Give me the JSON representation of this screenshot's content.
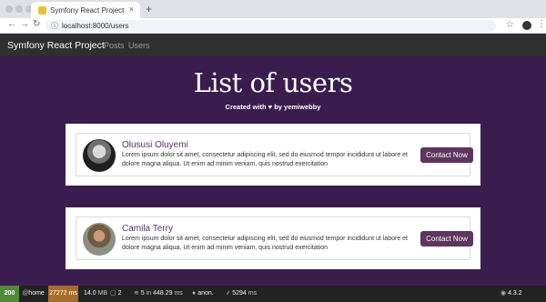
{
  "browser": {
    "tab_title": "Symfony React Project",
    "new_tab_label": "+",
    "close_label": "×",
    "url": "localhost:8000/users",
    "icons": {
      "back": "back-arrow-icon",
      "forward": "forward-arrow-icon",
      "reload": "reload-icon",
      "info": "info-icon",
      "star": "star-icon",
      "menu": "kebab-menu-icon"
    }
  },
  "navbar": {
    "brand": "Symfony React Project",
    "links": [
      {
        "label": "Posts"
      },
      {
        "label": "Users"
      }
    ]
  },
  "page": {
    "title": "List of users",
    "subtitle_prefix": "Created with",
    "subtitle_suffix": "by yemiwebby"
  },
  "users": [
    {
      "name": "Olususi Oluyemi",
      "bio": "Lorem ipsum dolor sit amet, consectetur adipiscing elit, sed do eiusmod tempor incididunt ut labore et dolore magna aliqua. Ut enim ad minim veniam, quis nostrud exercitation",
      "button": "Contact Now"
    },
    {
      "name": "Camila Terry",
      "bio": "Lorem ipsum dolor sit amet, consectetur adipiscing elit, sed do eiusmod tempor incididunt ut labore et dolore magna aliqua. Ut enim ad minim veniam, quis nostrud exercitation",
      "button": "Contact Now"
    }
  ],
  "toolbar": {
    "status": "200",
    "route": "home",
    "time": "27272",
    "time_unit": "ms",
    "memory": "14.0",
    "memory_unit": "MB",
    "requests": "2",
    "db_queries": "5",
    "db_in": "in",
    "db_time": "448.29",
    "db_unit": "ms",
    "user": "anon.",
    "render_time": "5294",
    "render_unit": "ms",
    "version": "4.3.2"
  },
  "colors": {
    "page_bg": "#3b1c4e",
    "accent": "#5d355e",
    "status_ok": "#4f8b39",
    "time_warn": "#a86d2a"
  }
}
